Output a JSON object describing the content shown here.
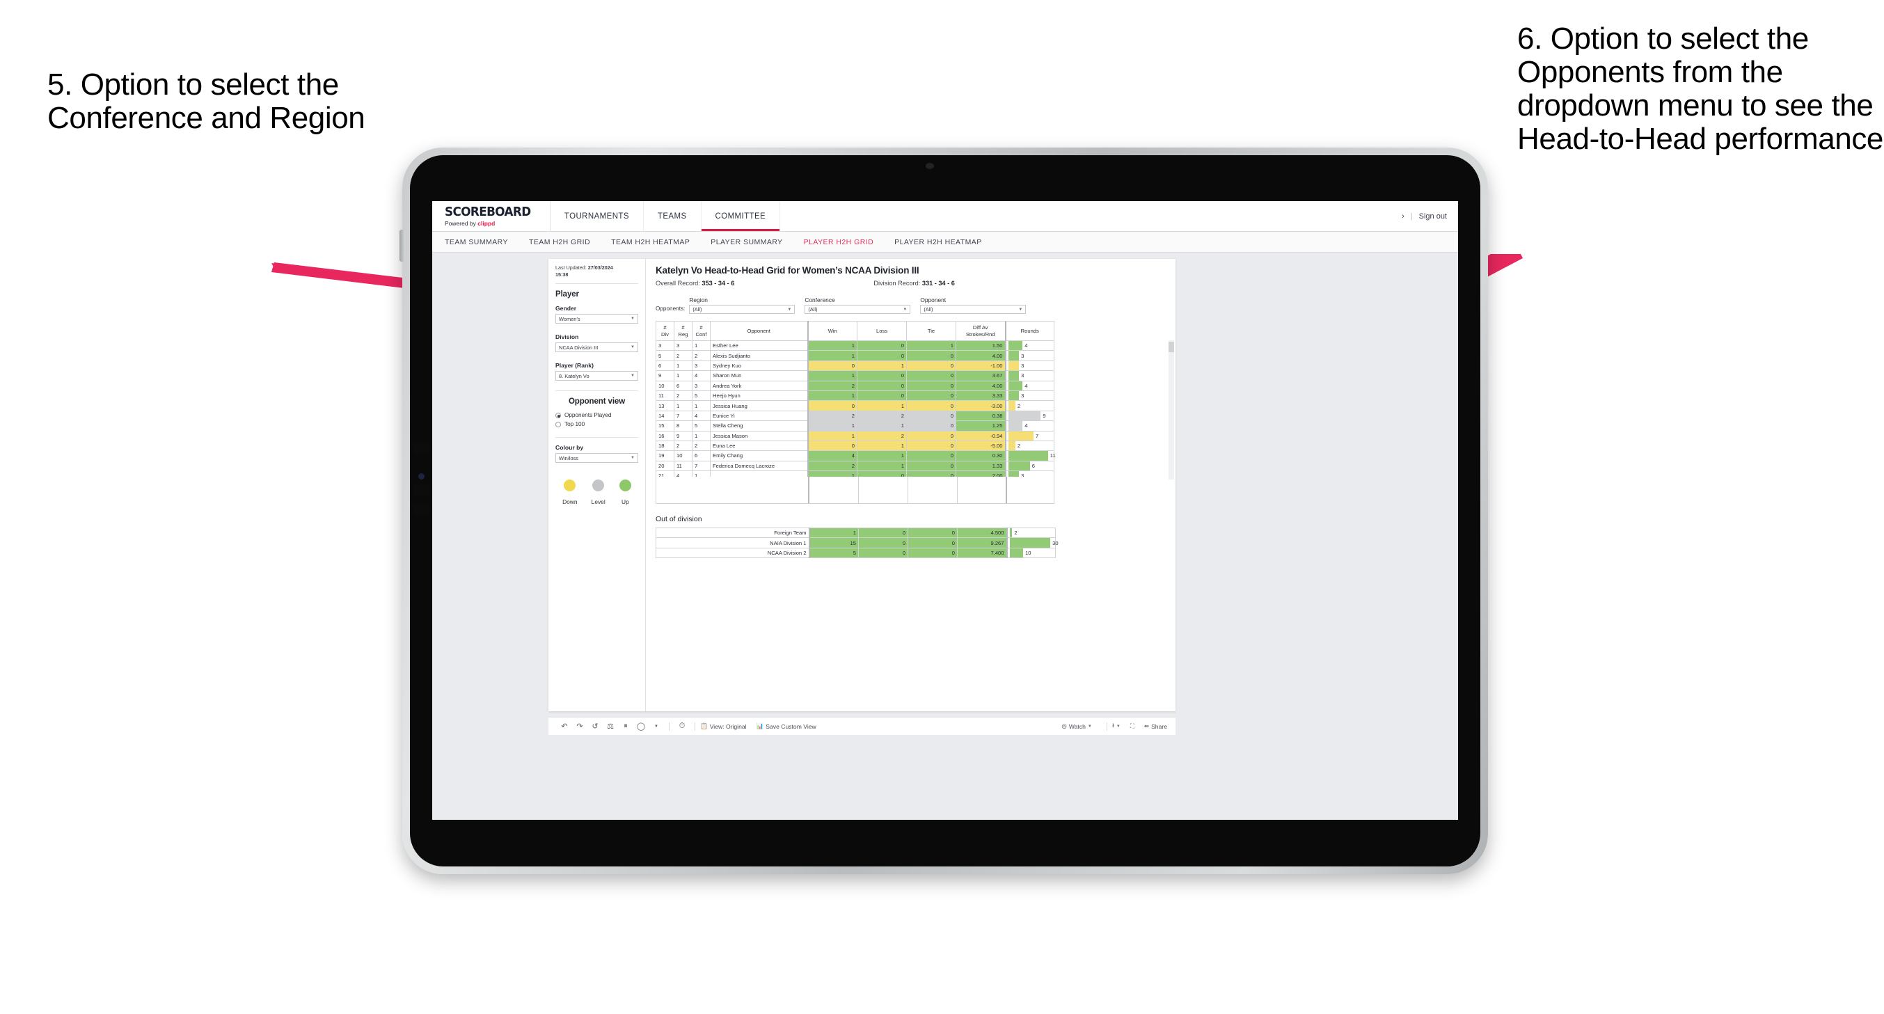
{
  "annotations": {
    "left": "5. Option to select the Conference and Region",
    "right": "6. Option to select the Opponents from the dropdown menu to see the Head-to-Head performance"
  },
  "app": {
    "brand": {
      "name": "SCOREBOARD",
      "powered_prefix": "Powered by ",
      "powered_brand": "clippd"
    },
    "nav": [
      {
        "label": "TOURNAMENTS",
        "active": false
      },
      {
        "label": "TEAMS",
        "active": false
      },
      {
        "label": "COMMITTEE",
        "active": true
      }
    ],
    "nav_right": {
      "chevron": "›",
      "separator": "|",
      "sign_out": "Sign out"
    },
    "subnav": [
      {
        "label": "TEAM SUMMARY",
        "active": false
      },
      {
        "label": "TEAM H2H GRID",
        "active": false
      },
      {
        "label": "TEAM H2H HEATMAP",
        "active": false
      },
      {
        "label": "PLAYER SUMMARY",
        "active": false
      },
      {
        "label": "PLAYER H2H GRID",
        "active": true
      },
      {
        "label": "PLAYER H2H HEATMAP",
        "active": false
      }
    ]
  },
  "panel": {
    "last_updated_label": "Last Updated: ",
    "last_updated_value": "27/03/2024",
    "last_updated_time": "15:38",
    "player_heading": "Player",
    "gender": {
      "label": "Gender",
      "value": "Women’s"
    },
    "division": {
      "label": "Division",
      "value": "NCAA Division III"
    },
    "player_rank": {
      "label": "Player (Rank)",
      "value": "8. Katelyn Vo"
    },
    "opponent_view": {
      "heading": "Opponent view",
      "options": [
        {
          "label": "Opponents Played",
          "selected": true
        },
        {
          "label": "Top 100",
          "selected": false
        }
      ]
    },
    "colour_by": {
      "label": "Colour by",
      "value": "Win/loss"
    },
    "legend": [
      {
        "label": "Down",
        "color": "#f2d84f"
      },
      {
        "label": "Level",
        "color": "#c3c5c8"
      },
      {
        "label": "Up",
        "color": "#8dc96a"
      }
    ]
  },
  "viz": {
    "title": "Katelyn Vo Head-to-Head Grid for Women’s NCAA Division III",
    "overall_record_label": "Overall Record: ",
    "overall_record_value": "353 - 34 - 6",
    "division_record_label": "Division Record: ",
    "division_record_value": "331 - 34 - 6",
    "opponents_label": "Opponents:",
    "filters": [
      {
        "label": "Region",
        "value": "(All)"
      },
      {
        "label": "Conference",
        "value": "(All)"
      },
      {
        "label": "Opponent",
        "value": "(All)"
      }
    ],
    "columns": [
      "#\nDiv",
      "#\nReg",
      "#\nConf",
      "Opponent",
      "Win",
      "Loss",
      "Tie",
      "Diff Av\nStrokes/Rnd",
      "Rounds"
    ],
    "columns_flat": [
      "# Div",
      "# Reg",
      "# Conf",
      "Opponent",
      "Win",
      "Loss",
      "Tie",
      "Diff Av Strokes/Rnd",
      "Rounds"
    ],
    "rows": [
      {
        "div": "3",
        "reg": "3",
        "conf": "1",
        "opponent": "Esther Lee",
        "win": "1",
        "loss": "0",
        "tie": "1",
        "diff": "1.50",
        "rounds": 4,
        "state": "up"
      },
      {
        "div": "5",
        "reg": "2",
        "conf": "2",
        "opponent": "Alexis Sudjianto",
        "win": "1",
        "loss": "0",
        "tie": "0",
        "diff": "4.00",
        "rounds": 3,
        "state": "up"
      },
      {
        "div": "6",
        "reg": "1",
        "conf": "3",
        "opponent": "Sydney Kuo",
        "win": "0",
        "loss": "1",
        "tie": "0",
        "diff": "-1.00",
        "rounds": 3,
        "state": "down"
      },
      {
        "div": "9",
        "reg": "1",
        "conf": "4",
        "opponent": "Sharon Mun",
        "win": "1",
        "loss": "0",
        "tie": "0",
        "diff": "3.67",
        "rounds": 3,
        "state": "up"
      },
      {
        "div": "10",
        "reg": "6",
        "conf": "3",
        "opponent": "Andrea York",
        "win": "2",
        "loss": "0",
        "tie": "0",
        "diff": "4.00",
        "rounds": 4,
        "state": "up"
      },
      {
        "div": "11",
        "reg": "2",
        "conf": "5",
        "opponent": "Heejo Hyun",
        "win": "1",
        "loss": "0",
        "tie": "0",
        "diff": "3.33",
        "rounds": 3,
        "state": "up"
      },
      {
        "div": "13",
        "reg": "1",
        "conf": "1",
        "opponent": "Jessica Huang",
        "win": "0",
        "loss": "1",
        "tie": "0",
        "diff": "-3.00",
        "rounds": 2,
        "state": "down"
      },
      {
        "div": "14",
        "reg": "7",
        "conf": "4",
        "opponent": "Eunice Yi",
        "win": "2",
        "loss": "2",
        "tie": "0",
        "diff": "0.38",
        "rounds": 9,
        "state": "level",
        "diff_state": "up"
      },
      {
        "div": "15",
        "reg": "8",
        "conf": "5",
        "opponent": "Stella Cheng",
        "win": "1",
        "loss": "1",
        "tie": "0",
        "diff": "1.25",
        "rounds": 4,
        "state": "level",
        "diff_state": "up"
      },
      {
        "div": "16",
        "reg": "9",
        "conf": "1",
        "opponent": "Jessica Mason",
        "win": "1",
        "loss": "2",
        "tie": "0",
        "diff": "-0.94",
        "rounds": 7,
        "state": "down"
      },
      {
        "div": "18",
        "reg": "2",
        "conf": "2",
        "opponent": "Euna Lee",
        "win": "0",
        "loss": "1",
        "tie": "0",
        "diff": "-5.00",
        "rounds": 2,
        "state": "down"
      },
      {
        "div": "19",
        "reg": "10",
        "conf": "6",
        "opponent": "Emily Chang",
        "win": "4",
        "loss": "1",
        "tie": "0",
        "diff": "0.30",
        "rounds": 11,
        "state": "up"
      },
      {
        "div": "20",
        "reg": "11",
        "conf": "7",
        "opponent": "Federica Domecq Lacroze",
        "win": "2",
        "loss": "1",
        "tie": "0",
        "diff": "1.33",
        "rounds": 6,
        "state": "up"
      }
    ],
    "rounds_max": 12,
    "out_of_division": {
      "heading": "Out of division",
      "rows": [
        {
          "name": "Foreign Team",
          "win": "1",
          "loss": "0",
          "tie": "0",
          "diff": "4.500",
          "rounds": 2,
          "state": "up"
        },
        {
          "name": "NAIA Division 1",
          "win": "15",
          "loss": "0",
          "tie": "0",
          "diff": "9.267",
          "rounds": 30,
          "state": "up"
        },
        {
          "name": "NCAA Division 2",
          "win": "5",
          "loss": "0",
          "tie": "0",
          "diff": "7.400",
          "rounds": 10,
          "state": "up"
        }
      ],
      "rounds_max": 32
    }
  },
  "toolbar": {
    "view_label": "View: Original",
    "save_label": "Save Custom View",
    "watch_label": "Watch",
    "share_label": "Share"
  },
  "colors": {
    "accent": "#d81c4a",
    "annotation_arrow": "#e8275f",
    "cell_up": "#93ca76",
    "cell_down": "#f5de74",
    "cell_level": "#d2d3d5"
  }
}
